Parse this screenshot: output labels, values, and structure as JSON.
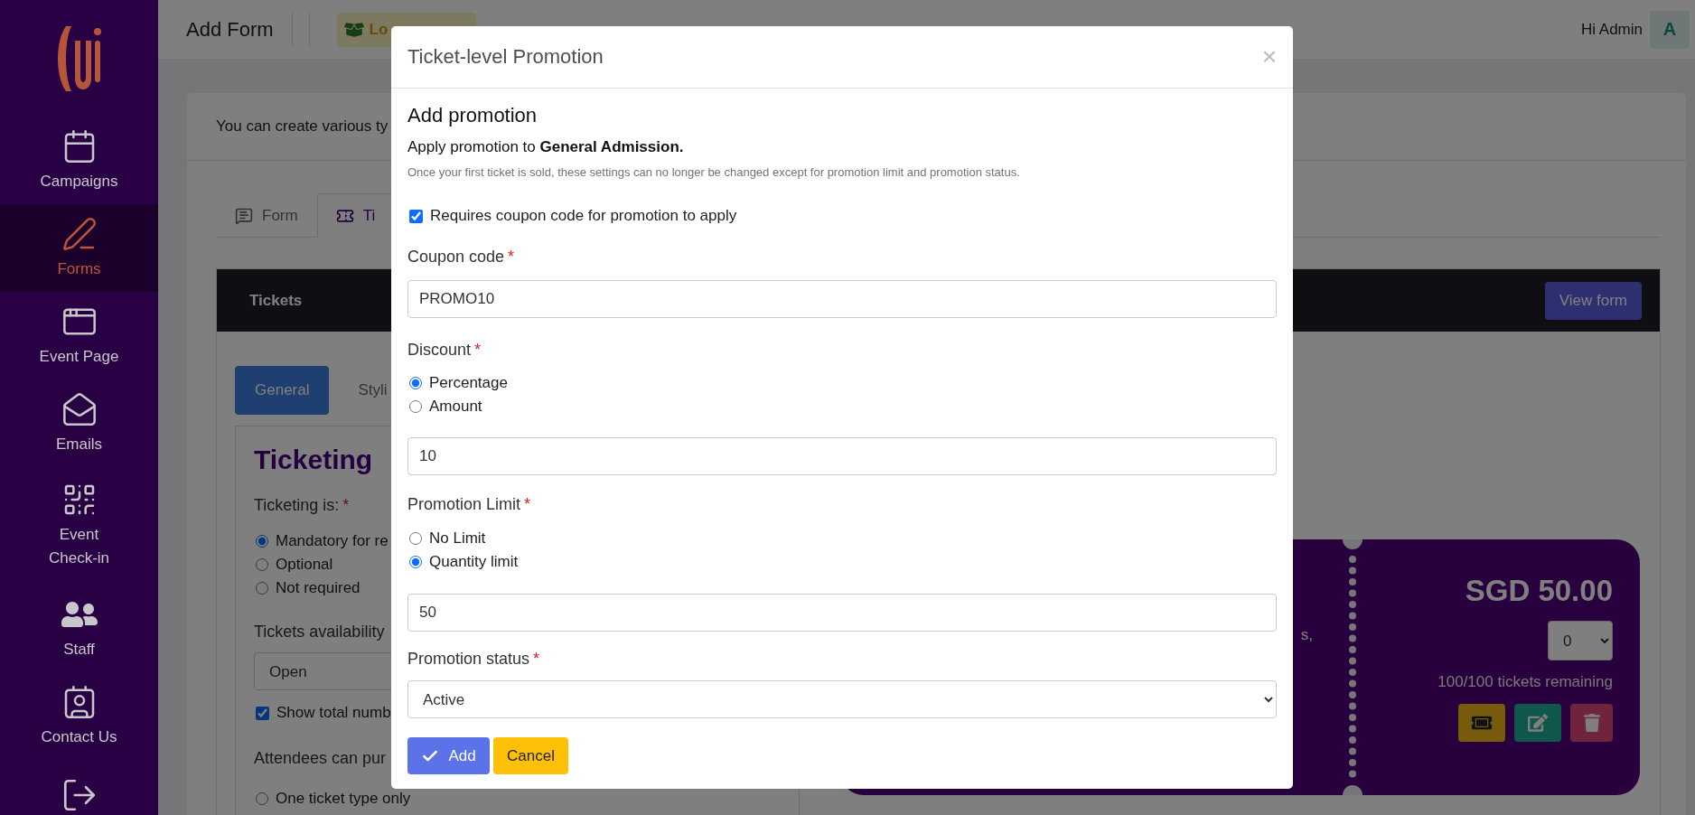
{
  "sidebar": {
    "items": [
      {
        "label": "Campaigns",
        "selected": false
      },
      {
        "label": "Forms",
        "selected": true
      },
      {
        "label": "Event Page",
        "selected": false
      },
      {
        "label": "Emails",
        "selected": false
      },
      {
        "label": "Event Check-in",
        "selected": false
      },
      {
        "label": "Staff",
        "selected": false
      },
      {
        "label": "Contact Us",
        "selected": false
      }
    ]
  },
  "topbar": {
    "title": "Add Form",
    "template_button": "Lo",
    "greeting": "Hi Admin",
    "avatar": "A"
  },
  "page": {
    "intro": "You can create various ty",
    "tabs": [
      {
        "label": "Form",
        "selected": false
      },
      {
        "label": "Ti",
        "selected": true
      }
    ],
    "panel_title": "Tickets",
    "view_button": "View form",
    "subtabs": [
      {
        "label": "General",
        "selected": true
      },
      {
        "label": "Styli",
        "selected": false
      }
    ],
    "settings": {
      "heading": "Ticketing",
      "ticketing_label": "Ticketing is:",
      "mark": "*",
      "ticketing_options": [
        {
          "label": "Mandatory for re",
          "selected": true
        },
        {
          "label": "Optional",
          "selected": false
        },
        {
          "label": "Not required",
          "selected": false
        }
      ],
      "availability_label": "Tickets availability",
      "availability_value": "Open",
      "show_total": {
        "label": "Show total numb",
        "checked": true
      },
      "purchase_label": "Attendees can pur",
      "purchase_options": [
        {
          "label": "One ticket type only",
          "selected": false
        }
      ]
    },
    "ticket": {
      "fragment": "s,",
      "price": "SGD 50.00",
      "quantity": "0",
      "remaining": "100/100 tickets remaining"
    }
  },
  "modal": {
    "title": "Ticket-level Promotion",
    "close": "×",
    "heading": "Add promotion",
    "apply_text": "Apply promotion to **General Admission.**",
    "note": "Once your first ticket is sold, these settings can no longer be changed except for promotion limit and promotion status.",
    "coupon_required": {
      "label": "Requires coupon code for promotion to apply",
      "checked": true
    },
    "coupon": {
      "label": "Coupon code",
      "mark": "*",
      "value": "PROMO10"
    },
    "discount": {
      "label": "Discount",
      "mark": "*",
      "options": [
        {
          "label": "Percentage",
          "selected": true
        },
        {
          "label": "Amount",
          "selected": false
        }
      ],
      "value": "10"
    },
    "limit": {
      "label": "Promotion Limit",
      "mark": "*",
      "options": [
        {
          "label": "No Limit",
          "selected": false
        },
        {
          "label": "Quantity limit",
          "selected": true
        }
      ],
      "value": "50"
    },
    "status": {
      "label": "Promotion status",
      "mark": "*",
      "value": "Active"
    },
    "buttons": {
      "add": "Add",
      "cancel": "Cancel"
    }
  }
}
